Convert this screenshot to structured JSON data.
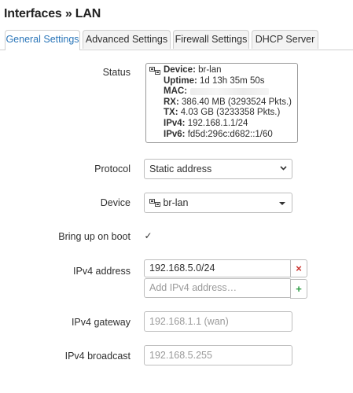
{
  "page": {
    "title": "Interfaces » LAN"
  },
  "tabs": [
    {
      "label": "General Settings",
      "active": true
    },
    {
      "label": "Advanced Settings",
      "active": false
    },
    {
      "label": "Firewall Settings",
      "active": false
    },
    {
      "label": "DHCP Server",
      "active": false
    }
  ],
  "status": {
    "label": "Status",
    "icon": "network-device-icon",
    "device_key": "Device:",
    "device_value": "br-lan",
    "uptime_key": "Uptime:",
    "uptime_value": "1d 13h 35m 50s",
    "mac_key": "MAC:",
    "rx_key": "RX:",
    "rx_value": "386.40 MB (3293524 Pkts.)",
    "tx_key": "TX:",
    "tx_value": "4.03 GB (3233358 Pkts.)",
    "ipv4_key": "IPv4:",
    "ipv4_value": "192.168.1.1/24",
    "ipv6_key": "IPv6:",
    "ipv6_value": "fd5d:296c:d682::1/60"
  },
  "protocol": {
    "label": "Protocol",
    "value": "Static address"
  },
  "device": {
    "label": "Device",
    "value": "br-lan",
    "icon": "network-device-icon"
  },
  "bring_up": {
    "label": "Bring up on boot",
    "checked": true,
    "mark": "✓"
  },
  "ipv4_address": {
    "label": "IPv4 address",
    "value": "192.168.5.0/24",
    "remove_symbol": "×",
    "add_placeholder": "Add IPv4 address…",
    "add_symbol": "+"
  },
  "ipv4_gateway": {
    "label": "IPv4 gateway",
    "placeholder": "192.168.1.1 (wan)"
  },
  "ipv4_broadcast": {
    "label": "IPv4 broadcast",
    "placeholder": "192.168.5.255"
  },
  "colors": {
    "accent": "#2b76b9",
    "remove": "#c9302c",
    "add": "#2e9d44"
  }
}
